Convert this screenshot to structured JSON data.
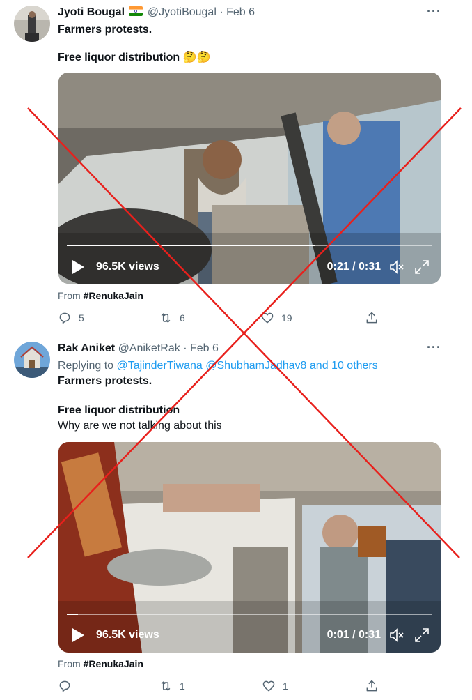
{
  "tweets": [
    {
      "name": "Jyoti Bougal",
      "handle": "@JyotiBougal",
      "separator": "·",
      "date": "Feb 6",
      "more": "···",
      "line1": "Farmers protests.",
      "line2": "Free liquor distribution 🤔🤔",
      "video": {
        "views": "96.5K views",
        "time": "0:21 / 0:31",
        "progress": 0.68
      },
      "from_label": "From",
      "from_tag": "#RenukaJain",
      "replies": "5",
      "retweets": "6",
      "likes": "19"
    },
    {
      "name": "Rak Aniket",
      "handle": "@AniketRak",
      "separator": "·",
      "date": "Feb 6",
      "more": "···",
      "replying_prefix": "Replying to",
      "reply_user1": "@TajinderTiwana",
      "reply_user2": "@ShubhamJadhav8",
      "reply_others": "and 10 others",
      "line1": "Farmers protests.",
      "line2": "Free liquor distribution",
      "line3": "Why are we not talking about this",
      "video": {
        "views": "96.5K views",
        "time": "0:01 / 0:31",
        "progress": 0.03
      },
      "from_label": "From",
      "from_tag": "#RenukaJain",
      "replies": "",
      "retweets": "1",
      "likes": "1"
    }
  ],
  "colors": {
    "cross": "#e8201c",
    "link": "#1d9bf0",
    "muted": "#536471"
  }
}
